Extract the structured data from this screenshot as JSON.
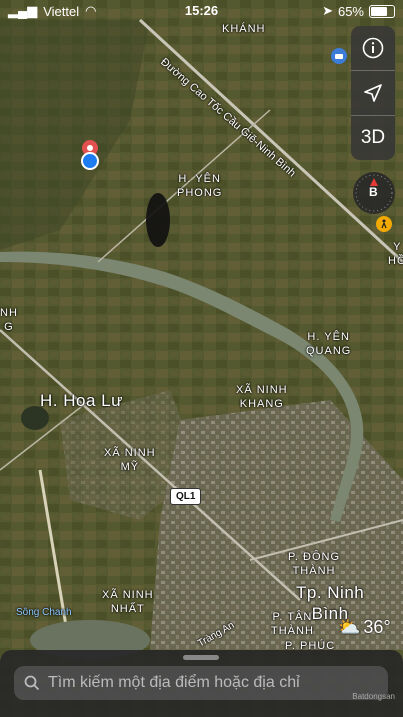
{
  "status": {
    "carrier": "Viettel",
    "time": "15:26",
    "battery": "65%",
    "battery_level": 0.65
  },
  "controls": {
    "info_icon": "info-icon",
    "location_icon": "location-arrow-icon",
    "three_d_label": "3D",
    "compass_letter": "B"
  },
  "map_labels": {
    "khanh": "KHÁNH",
    "expressway": "Đường Cao Tốc Cầu Giẽ-Ninh Bình",
    "yen_phong_1": "H. YÊN",
    "yen_phong_2": "PHONG",
    "yen_hung_1": "Y",
    "yen_hung_2": "HỒ",
    "left_nh_1": "NH",
    "left_nh_2": "G",
    "yen_quang_1": "H. YÊN",
    "yen_quang_2": "QUANG",
    "ninh_khang_1": "XÃ NINH",
    "ninh_khang_2": "KHANG",
    "hoa_lu": "H. Hoa Lư",
    "ninh_my_1": "XÃ NINH",
    "ninh_my_2": "MỸ",
    "qli_shield": "QL1",
    "ninh_nhat_1": "XÃ NINH",
    "ninh_nhat_2": "NHẤT",
    "dong_thanh_1": "P. ĐÔNG",
    "dong_thanh_2": "THÀNH",
    "tp_ninh_binh_1": "Tp. Ninh",
    "tp_ninh_binh_2": "Bình",
    "tan_thanh_1": "P. TÂN",
    "tan_thanh_2": "THÀNH",
    "phuc": "P. PHÚC",
    "song_chanh": "Sông Chanh",
    "trang_an": "Tràng An"
  },
  "weather": {
    "temperature": "36°"
  },
  "search": {
    "placeholder": "Tìm kiếm một địa điểm hoặc địa chỉ"
  },
  "watermark": "Batdongsan"
}
